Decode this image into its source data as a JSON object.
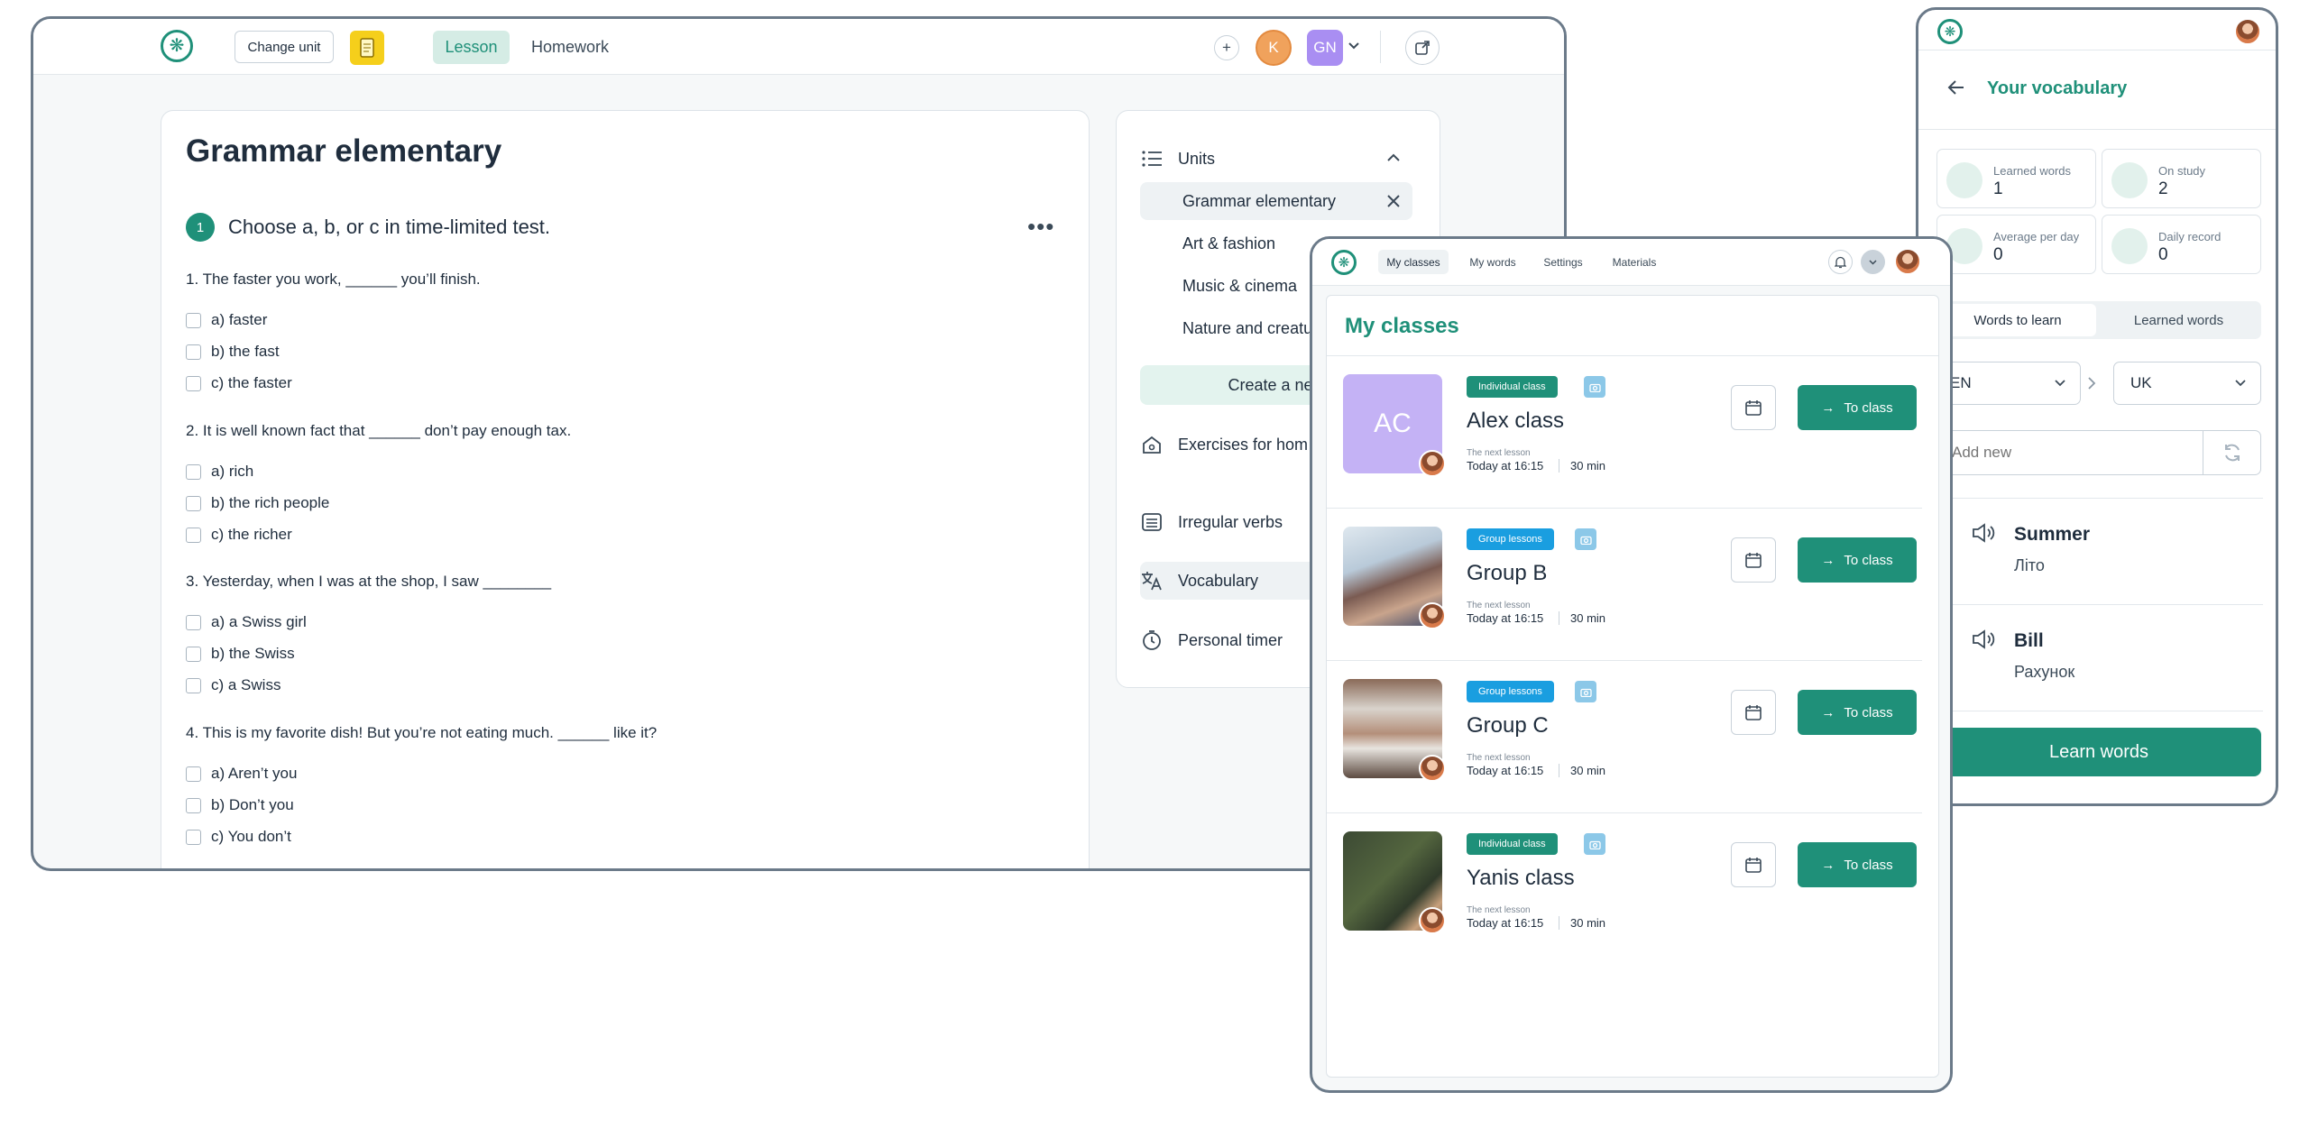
{
  "lesson_window": {
    "change_unit_label": "Change unit",
    "tabs": [
      {
        "label": "Lesson"
      },
      {
        "label": "Homework"
      }
    ],
    "avatar_k": "K",
    "avatar_gn": "GN",
    "title": "Grammar elementary",
    "exercise": {
      "number": "1",
      "title": "Choose a, b, or c in time-limited test."
    },
    "questions": [
      {
        "text": "1.  The faster you work, ______ you’ll finish.",
        "options": [
          "a) faster",
          "b) the fast",
          "c) the faster"
        ]
      },
      {
        "text": "2.  It is well known fact that ______ don’t pay enough tax.",
        "options": [
          "a) rich",
          "b) the rich people",
          "c) the richer"
        ]
      },
      {
        "text": "3.  Yesterday, when I was at the shop, I saw ________",
        "options": [
          "a) a Swiss girl",
          "b) the Swiss",
          "c) a Swiss"
        ]
      },
      {
        "text": "4.  This is my favorite dish! But you’re not eating much. ______ like it?",
        "options": [
          "a) Aren’t you",
          "b) Don’t you",
          "c) You don’t"
        ]
      }
    ],
    "units_label": "Units",
    "units": [
      "Grammar elementary",
      "Art & fashion",
      "Music & cinema",
      "Nature and creatu"
    ],
    "create_new": "Create a new",
    "side_menu": [
      "Exercises for hom",
      "Irregular verbs",
      "Vocabulary",
      "Personal timer"
    ],
    "colors": {
      "accent": "#1f9079",
      "k": "#f0a25c",
      "gn": "#a98ef2"
    }
  },
  "classes_window": {
    "nav": [
      "My classes",
      "My words",
      "Settings",
      "Materials"
    ],
    "title": "My classes",
    "next_lesson_label": "The next lesson",
    "to_class_label": "To class",
    "classes": [
      {
        "initials": "AC",
        "badge": "Individual class",
        "name": "Alex class",
        "time": "Today at 16:15",
        "duration": "30 min"
      },
      {
        "badge": "Group lessons",
        "name": "Group B",
        "time": "Today at 16:15",
        "duration": "30 min"
      },
      {
        "badge": "Group lessons",
        "name": "Group C",
        "time": "Today at 16:15",
        "duration": "30 min"
      },
      {
        "badge": "Individual class",
        "name": "Yanis class",
        "time": "Today at 16:15",
        "duration": "30 min"
      }
    ]
  },
  "vocab_window": {
    "title": "Your vocabulary",
    "stats": [
      {
        "label": "Learned words",
        "value": "1"
      },
      {
        "label": "On study",
        "value": "2"
      },
      {
        "label": "Average per day",
        "value": "0"
      },
      {
        "label": "Daily record",
        "value": "0"
      }
    ],
    "tabs": [
      "Words to learn",
      "Learned words"
    ],
    "lang_from": "EN",
    "lang_to": "UK",
    "add_placeholder": "Add new",
    "words": [
      {
        "word": "Summer",
        "translation": "Літо"
      },
      {
        "word": "Bill",
        "translation": "Рахунок"
      }
    ],
    "learn_button": "Learn words"
  }
}
